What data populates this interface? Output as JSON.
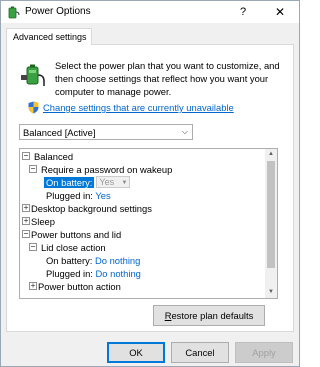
{
  "window": {
    "title": "Power Options",
    "help_glyph": "?",
    "close_glyph": "✕"
  },
  "tabs": [
    {
      "label": "Advanced settings"
    }
  ],
  "intro": {
    "text": "Select the power plan that you want to customize, and then choose settings that reflect how you want your computer to manage power."
  },
  "change_link": {
    "label": "Change settings that are currently unavailable"
  },
  "plan": {
    "selected": "Balanced [Active]"
  },
  "tree": {
    "rows": [
      {
        "expander": "−",
        "label": "Balanced"
      },
      {
        "expander": "−",
        "label": "Require a password on wakeup"
      },
      {
        "label": "On battery:",
        "value": "Yes"
      },
      {
        "label": "Plugged in:",
        "value": "Yes"
      },
      {
        "expander": "+",
        "label": "Desktop background settings"
      },
      {
        "expander": "+",
        "label": "Sleep"
      },
      {
        "expander": "−",
        "label": "Power buttons and lid"
      },
      {
        "expander": "−",
        "label": "Lid close action"
      },
      {
        "label": "On battery:",
        "value": "Do nothing"
      },
      {
        "label": "Plugged in:",
        "value": "Do nothing"
      },
      {
        "expander": "+",
        "label": "Power button action"
      }
    ]
  },
  "scrollbar": {
    "up_glyph": "▲",
    "down_glyph": "▼"
  },
  "buttons": {
    "restore_prefix": "R",
    "restore_rest": "estore plan defaults",
    "ok": "OK",
    "cancel": "Cancel",
    "apply": "Apply"
  },
  "icons": {
    "app": "power-options-icon",
    "battery": "battery-plug-icon",
    "shield": "uac-shield-icon",
    "dropdown": "chevron-down-icon"
  },
  "colors": {
    "link": "#0066cc",
    "selection": "#0078d7"
  }
}
